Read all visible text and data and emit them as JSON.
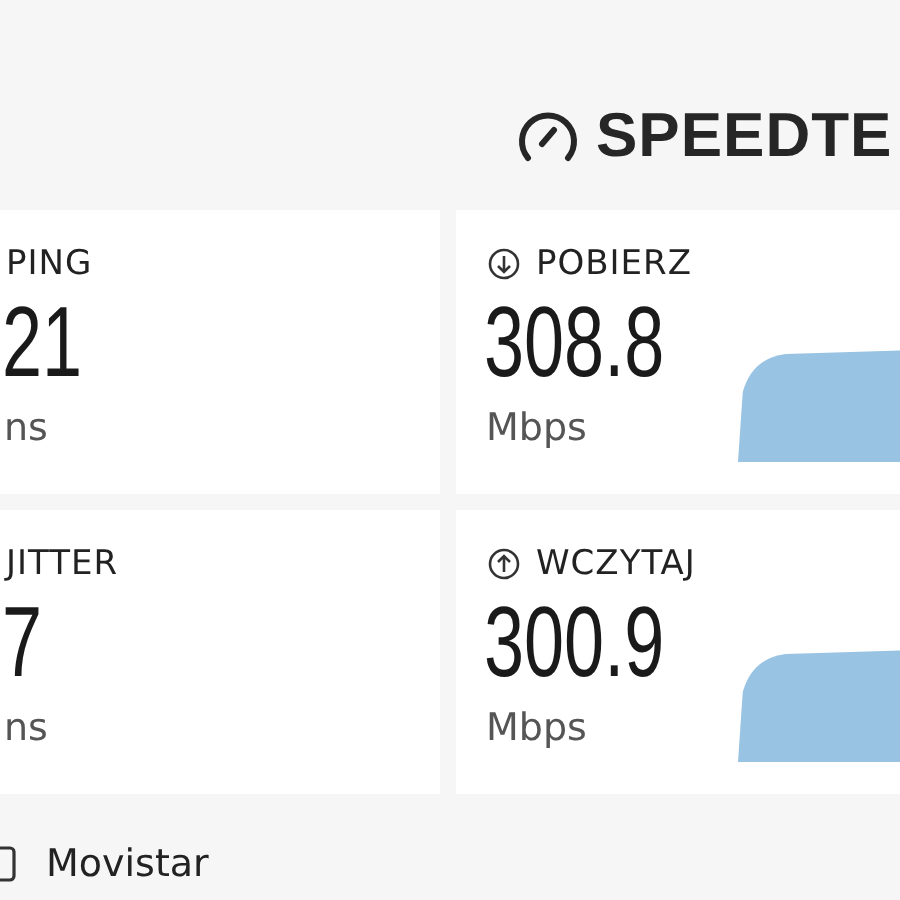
{
  "brand": {
    "name": "SPEEDTE"
  },
  "metrics": [
    {
      "kind": "latency",
      "label": "PING",
      "value": "21",
      "unit": "ns"
    },
    {
      "kind": "download",
      "label": "POBIERZ",
      "value": "308.8",
      "unit": "Mbps"
    },
    {
      "kind": "latency",
      "label": "JITTER",
      "value": "7",
      "unit": "ns"
    },
    {
      "kind": "upload",
      "label": "WCZYTAJ",
      "value": "300.9",
      "unit": "Mbps"
    }
  ],
  "provider": {
    "name": "Movistar"
  }
}
